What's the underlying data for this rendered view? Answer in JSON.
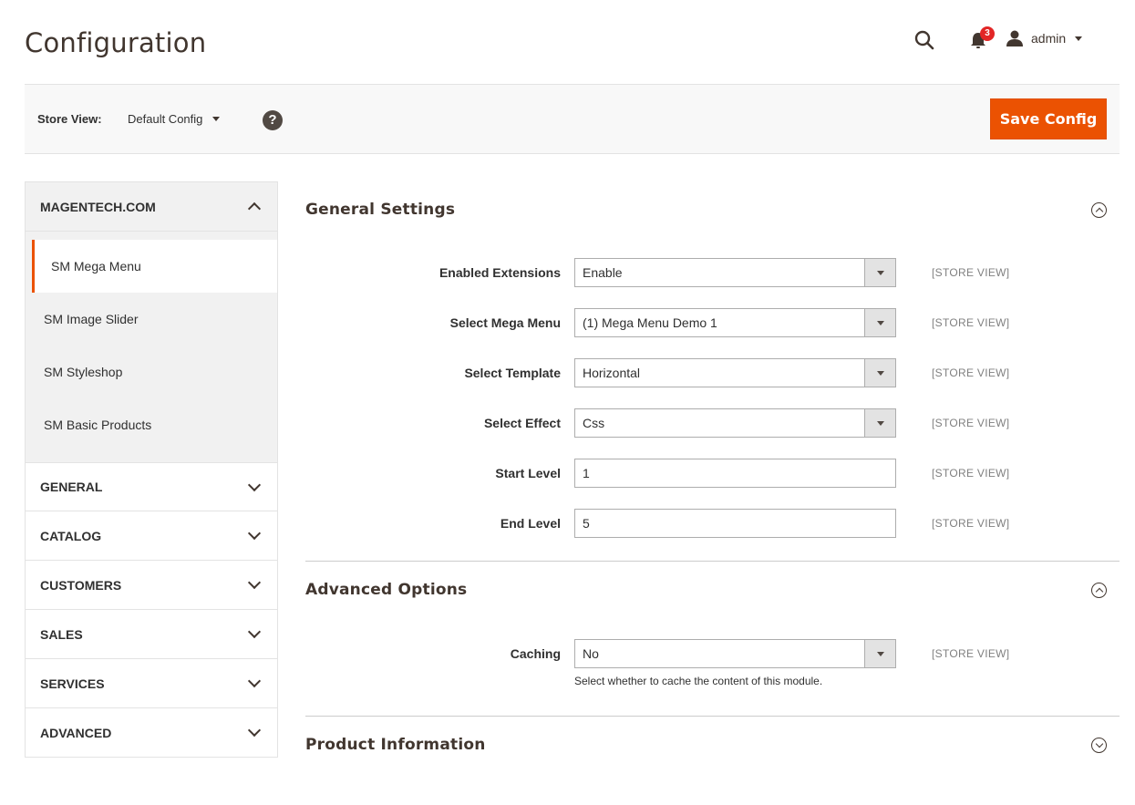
{
  "page": {
    "title": "Configuration"
  },
  "header": {
    "notifications_count": "3",
    "user_label": "admin"
  },
  "store_bar": {
    "label": "Store View:",
    "value": "Default Config",
    "help_glyph": "?",
    "save_label": "Save Config"
  },
  "sidebar": {
    "group": {
      "label": "MAGENTECH.COM",
      "items": [
        "SM Mega Menu",
        "SM Image Slider",
        "SM Styleshop",
        "SM Basic Products"
      ]
    },
    "sections": [
      "GENERAL",
      "CATALOG",
      "CUSTOMERS",
      "SALES",
      "SERVICES",
      "ADVANCED"
    ]
  },
  "general_settings": {
    "title": "General Settings",
    "fields": [
      {
        "label": "Enabled Extensions",
        "value": "Enable",
        "scope": "[STORE VIEW]"
      },
      {
        "label": "Select Mega Menu",
        "value": "(1) Mega Menu Demo 1",
        "scope": "[STORE VIEW]"
      },
      {
        "label": "Select Template",
        "value": "Horizontal",
        "scope": "[STORE VIEW]"
      },
      {
        "label": "Select Effect",
        "value": "Css",
        "scope": "[STORE VIEW]"
      },
      {
        "label": "Start Level",
        "value": "1",
        "scope": "[STORE VIEW]"
      },
      {
        "label": "End Level",
        "value": "5",
        "scope": "[STORE VIEW]"
      }
    ]
  },
  "advanced_options": {
    "title": "Advanced Options",
    "caching": {
      "label": "Caching",
      "value": "No",
      "scope": "[STORE VIEW]",
      "note": "Select whether to cache the content of this module."
    }
  },
  "product_information": {
    "title": "Product Information"
  },
  "colors": {
    "accent": "#eb5202",
    "badge": "#e22626"
  }
}
